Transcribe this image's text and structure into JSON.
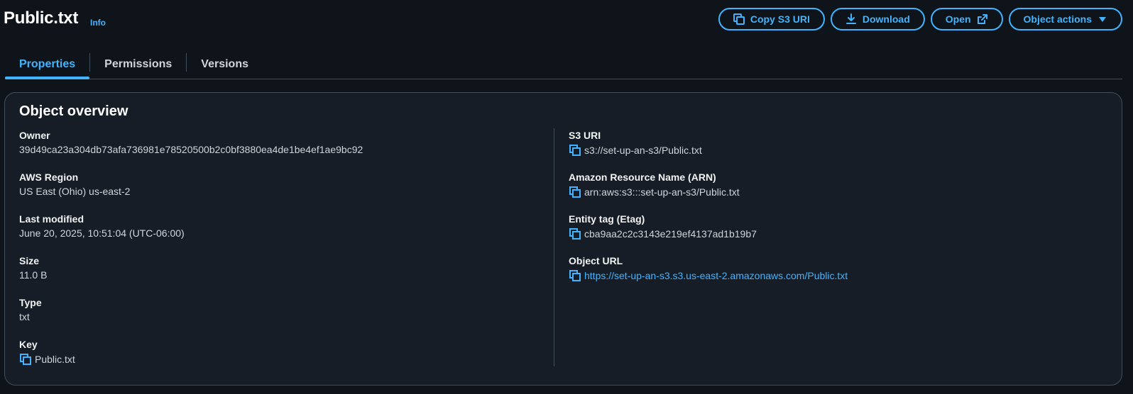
{
  "header": {
    "title": "Public.txt",
    "info_label": "Info",
    "buttons": {
      "copy_s3_uri": "Copy S3 URI",
      "download": "Download",
      "open": "Open",
      "object_actions": "Object actions"
    }
  },
  "tabs": [
    {
      "label": "Properties",
      "active": true
    },
    {
      "label": "Permissions",
      "active": false
    },
    {
      "label": "Versions",
      "active": false
    }
  ],
  "overview": {
    "title": "Object overview",
    "left": {
      "owner": {
        "label": "Owner",
        "value": "39d49ca23a304db73afa736981e78520500b2c0bf3880ea4de1be4ef1ae9bc92"
      },
      "region": {
        "label": "AWS Region",
        "value": "US East (Ohio) us-east-2"
      },
      "last_modified": {
        "label": "Last modified",
        "value": "June 20, 2025, 10:51:04 (UTC-06:00)"
      },
      "size": {
        "label": "Size",
        "value": "11.0 B"
      },
      "type": {
        "label": "Type",
        "value": "txt"
      },
      "key": {
        "label": "Key",
        "value": "Public.txt"
      }
    },
    "right": {
      "s3_uri": {
        "label": "S3 URI",
        "value": "s3://set-up-an-s3/Public.txt"
      },
      "arn": {
        "label": "Amazon Resource Name (ARN)",
        "value": "arn:aws:s3:::set-up-an-s3/Public.txt"
      },
      "etag": {
        "label": "Entity tag (Etag)",
        "value": "cba9aa2c2c3143e219ef4137ad1b19b7"
      },
      "object_url": {
        "label": "Object URL",
        "value": "https://set-up-an-s3.s3.us-east-2.amazonaws.com/Public.txt"
      }
    }
  },
  "colors": {
    "background": "#0f141a",
    "panel": "#161d26",
    "accent": "#42b4ff",
    "border": "#414d5c"
  }
}
